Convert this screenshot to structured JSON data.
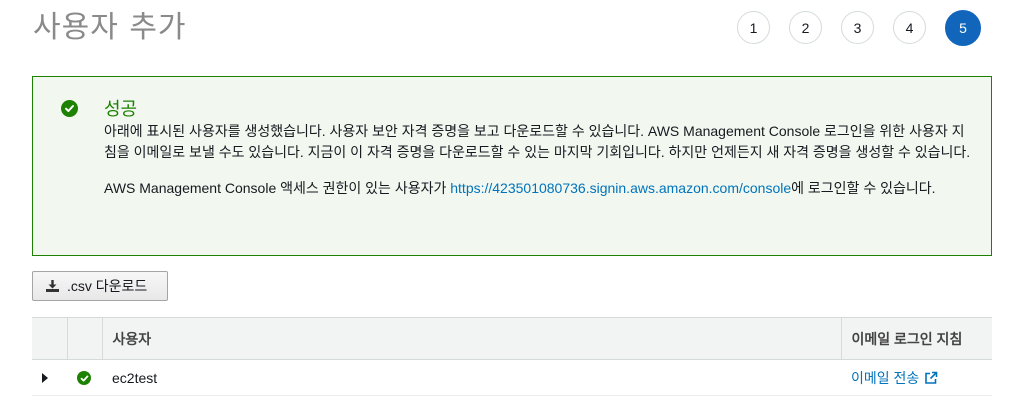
{
  "page": {
    "title": "사용자 추가"
  },
  "steps": {
    "items": [
      "1",
      "2",
      "3",
      "4",
      "5"
    ],
    "active": "5"
  },
  "alert": {
    "title": "성공",
    "message1": "아래에 표시된 사용자를 생성했습니다. 사용자 보안 자격 증명을 보고 다운로드할 수 있습니다. AWS Management Console 로그인을 위한 사용자 지침을 이메일로 보낼 수도 있습니다. 지금이 이 자격 증명을 다운로드할 수 있는 마지막 기회입니다. 하지만 언제든지 새 자격 증명을 생성할 수 있습니다.",
    "message2_prefix": "AWS Management Console 액세스 권한이 있는 사용자가 ",
    "console_url": "https://423501080736.signin.aws.amazon.com/console",
    "message2_suffix": "에 로그인할 수 있습니다.",
    "accent_color": "#1d8102"
  },
  "toolbar": {
    "download_label": ".csv 다운로드",
    "download_icon": "download-icon"
  },
  "table": {
    "headers": {
      "user": "사용자",
      "email": "이메일 로그인 지침"
    },
    "rows": [
      {
        "user": "ec2test",
        "email_action": "이메일 전송",
        "status_icon": "success-check-icon",
        "expand_icon": "caret-right-icon"
      }
    ]
  },
  "colors": {
    "link": "#0073bb",
    "active_step": "#1166bb",
    "success": "#1d8102"
  }
}
